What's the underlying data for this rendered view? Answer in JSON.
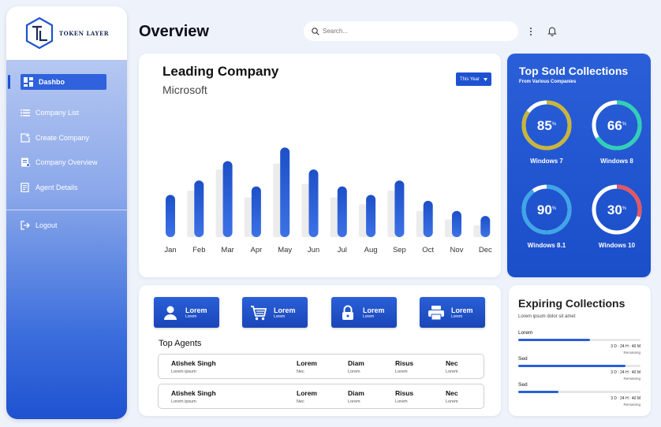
{
  "brand": {
    "name": "TOKEN LAYER",
    "accent": "#1f52d1"
  },
  "sidebar": {
    "items": [
      {
        "label": "Dashbo",
        "icon": "dashboard-icon",
        "active": true
      },
      {
        "label": "Company List",
        "icon": "list-icon"
      },
      {
        "label": "Create Company",
        "icon": "add-box-icon"
      },
      {
        "label": "Company Overview",
        "icon": "document-icon"
      },
      {
        "label": "Agent Details",
        "icon": "id-card-icon"
      }
    ],
    "logout": "Logout"
  },
  "header": {
    "title": "Overview",
    "search_placeholder": "Search..."
  },
  "chart_card": {
    "title": "Leading Company",
    "subtitle": "Microsoft",
    "filter": "This Year"
  },
  "chart_data": {
    "type": "bar",
    "categories": [
      "Jan",
      "Feb",
      "Mar",
      "Apr",
      "May",
      "Jun",
      "Jul",
      "Aug",
      "Sep",
      "Oct",
      "Nov",
      "Dec"
    ],
    "series": [
      {
        "values": [
          0,
          55,
          80,
          47,
          87,
          63,
          47,
          39,
          55,
          31,
          21,
          14
        ],
        "color": "#ececec"
      },
      {
        "values": [
          50,
          67,
          90,
          60,
          106,
          80,
          60,
          50,
          67,
          43,
          31,
          25
        ],
        "color": "#1f52d1"
      }
    ],
    "ylim": [
      0,
      110
    ],
    "grid": false
  },
  "top_sold": {
    "title": "Top Sold Collections",
    "subtitle": "From Various Companies",
    "items": [
      {
        "value": "85",
        "unit": "%",
        "percent": 85,
        "label": "Windows 7",
        "color": "#c9b53a"
      },
      {
        "value": "66",
        "unit": "%",
        "percent": 66,
        "label": "Windows 8",
        "color": "#2fd0b4"
      },
      {
        "value": "90",
        "unit": "%",
        "percent": 90,
        "label": "Windows 8.1",
        "color": "#3ea6e8"
      },
      {
        "value": "30",
        "unit": "%",
        "percent": 30,
        "label": "Windows 10",
        "color": "#e8565e"
      }
    ]
  },
  "quick_buttons": [
    {
      "label": "Lorem",
      "sub": "Lorem",
      "icon": "person-icon"
    },
    {
      "label": "Lorem",
      "sub": "Lorem",
      "icon": "cart-icon"
    },
    {
      "label": "Lorem",
      "sub": "Lorem",
      "icon": "lock-icon"
    },
    {
      "label": "Lorem",
      "sub": "Lorem",
      "icon": "printer-icon"
    }
  ],
  "top_agents": {
    "title": "Top Agents",
    "rows": [
      {
        "name": "Atishek Singh",
        "name_sub": "Lorem ipsum",
        "c1": "Lorem",
        "c1_sub": "Nec",
        "c2": "Diam",
        "c2_sub": "Lorem",
        "c3": "Risus",
        "c3_sub": "Lorem",
        "c4": "Nec",
        "c4_sub": "Lorem"
      },
      {
        "name": "Atishek Singh",
        "name_sub": "Lorem ipsum",
        "c1": "Lorem",
        "c1_sub": "Nec",
        "c2": "Diam",
        "c2_sub": "Lorem",
        "c3": "Risus",
        "c3_sub": "Lorem",
        "c4": "Nec",
        "c4_sub": "Lorem"
      }
    ]
  },
  "expiring": {
    "title": "Expiring Collections",
    "subtitle": "Lorem ipsum dolor sit amet",
    "items": [
      {
        "label": "Lorem",
        "progress": 0.59,
        "time": "3 D : 24 H : 40 M",
        "remaining": "Remaining"
      },
      {
        "label": "Sed",
        "progress": 0.88,
        "time": "3 D : 24 H : 40 M",
        "remaining": "Remaining"
      },
      {
        "label": "Sed",
        "progress": 0.33,
        "time": "3 D : 24 H : 40 M",
        "remaining": "Remaining"
      }
    ]
  }
}
